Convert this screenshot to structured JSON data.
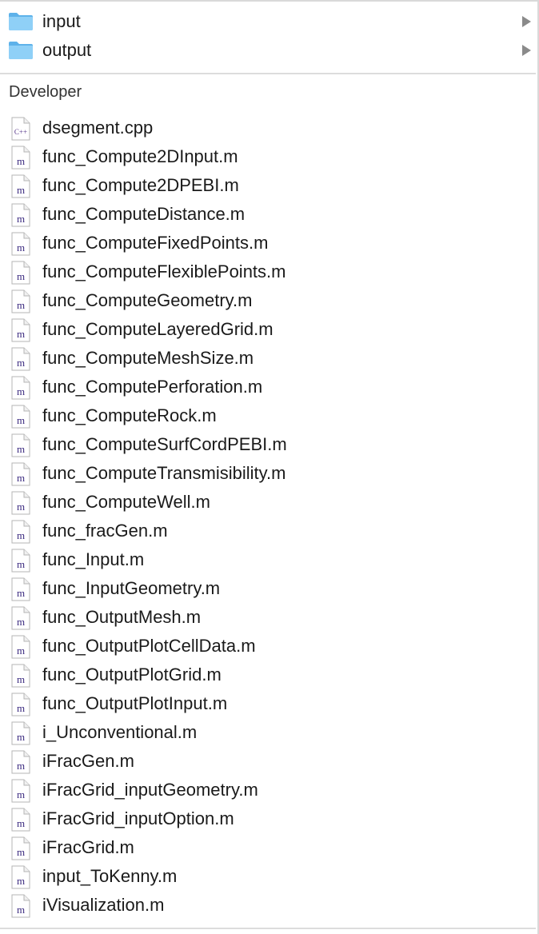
{
  "folders": [
    {
      "label": "input"
    },
    {
      "label": "output"
    }
  ],
  "section": {
    "title": "Developer"
  },
  "files": [
    {
      "name": "dsegment.cpp",
      "type": "cpp",
      "badge": "C++"
    },
    {
      "name": "func_Compute2DInput.m",
      "type": "m",
      "badge": "m"
    },
    {
      "name": "func_Compute2DPEBI.m",
      "type": "m",
      "badge": "m"
    },
    {
      "name": "func_ComputeDistance.m",
      "type": "m",
      "badge": "m"
    },
    {
      "name": "func_ComputeFixedPoints.m",
      "type": "m",
      "badge": "m"
    },
    {
      "name": "func_ComputeFlexiblePoints.m",
      "type": "m",
      "badge": "m"
    },
    {
      "name": "func_ComputeGeometry.m",
      "type": "m",
      "badge": "m"
    },
    {
      "name": "func_ComputeLayeredGrid.m",
      "type": "m",
      "badge": "m"
    },
    {
      "name": "func_ComputeMeshSize.m",
      "type": "m",
      "badge": "m"
    },
    {
      "name": "func_ComputePerforation.m",
      "type": "m",
      "badge": "m"
    },
    {
      "name": "func_ComputeRock.m",
      "type": "m",
      "badge": "m"
    },
    {
      "name": "func_ComputeSurfCordPEBI.m",
      "type": "m",
      "badge": "m"
    },
    {
      "name": "func_ComputeTransmisibility.m",
      "type": "m",
      "badge": "m"
    },
    {
      "name": "func_ComputeWell.m",
      "type": "m",
      "badge": "m"
    },
    {
      "name": "func_fracGen.m",
      "type": "m",
      "badge": "m"
    },
    {
      "name": "func_Input.m",
      "type": "m",
      "badge": "m"
    },
    {
      "name": "func_InputGeometry.m",
      "type": "m",
      "badge": "m"
    },
    {
      "name": "func_OutputMesh.m",
      "type": "m",
      "badge": "m"
    },
    {
      "name": "func_OutputPlotCellData.m",
      "type": "m",
      "badge": "m"
    },
    {
      "name": "func_OutputPlotGrid.m",
      "type": "m",
      "badge": "m"
    },
    {
      "name": "func_OutputPlotInput.m",
      "type": "m",
      "badge": "m"
    },
    {
      "name": "i_Unconventional.m",
      "type": "m",
      "badge": "m"
    },
    {
      "name": "iFracGen.m",
      "type": "m",
      "badge": "m"
    },
    {
      "name": "iFracGrid_inputGeometry.m",
      "type": "m",
      "badge": "m"
    },
    {
      "name": "iFracGrid_inputOption.m",
      "type": "m",
      "badge": "m"
    },
    {
      "name": "iFracGrid.m",
      "type": "m",
      "badge": "m"
    },
    {
      "name": "input_ToKenny.m",
      "type": "m",
      "badge": "m"
    },
    {
      "name": "iVisualization.m",
      "type": "m",
      "badge": "m"
    }
  ],
  "colors": {
    "folder_body": "#7cc4f2",
    "folder_tab": "#5eb2ea",
    "m_badge": "#3b2a80",
    "cpp_badge": "#5a3a8c"
  }
}
